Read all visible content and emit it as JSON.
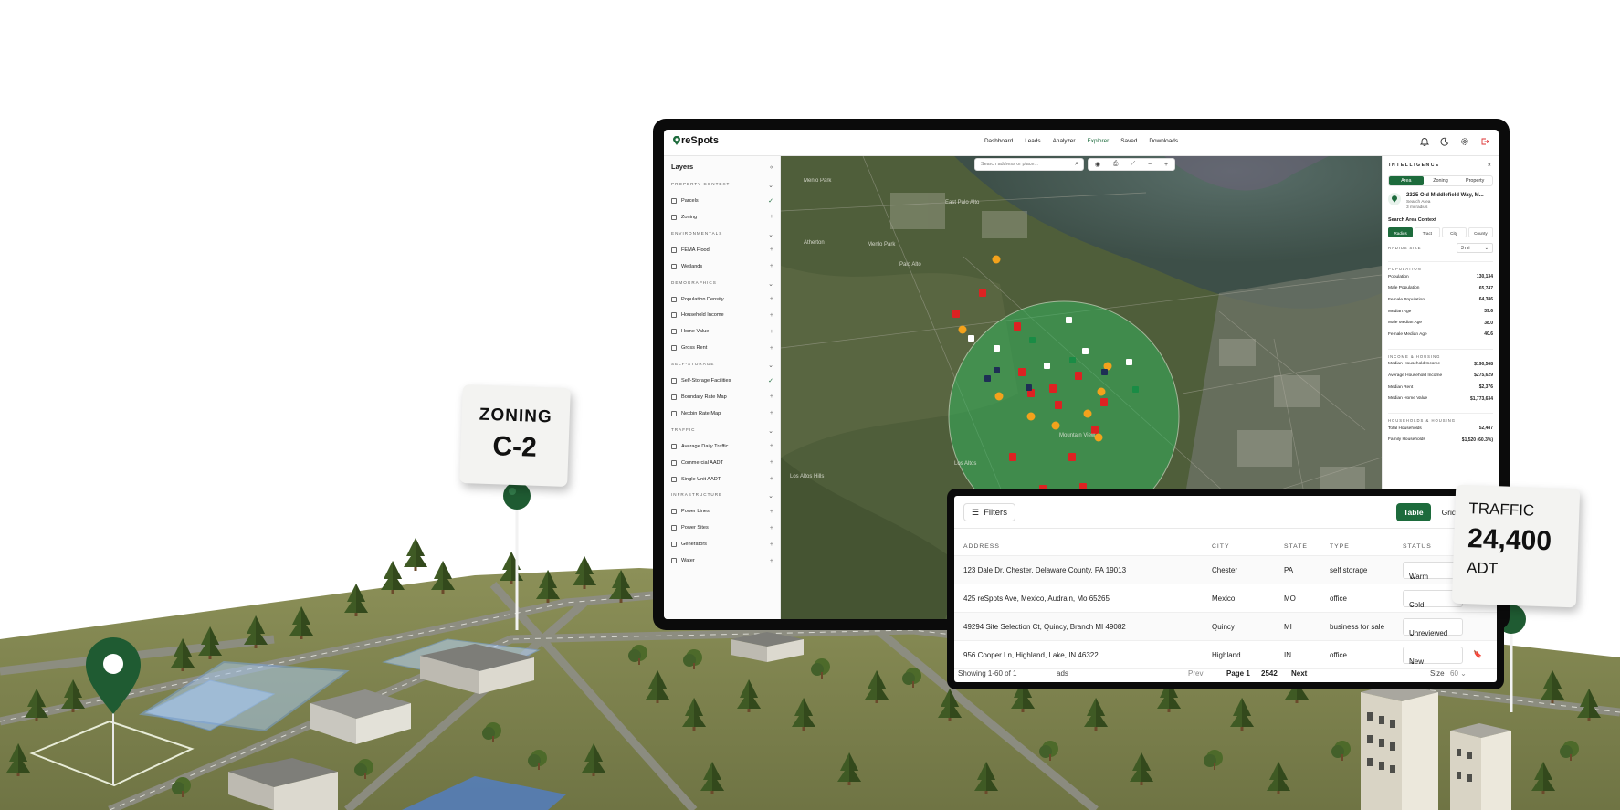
{
  "app": {
    "brand": "reSpots",
    "nav": [
      "Dashboard",
      "Leads",
      "Analyzer",
      "Explorer",
      "Saved",
      "Downloads"
    ],
    "active_nav": "Explorer",
    "accent": "#1d6b3c"
  },
  "layers": {
    "title": "Layers",
    "collapse_icon": "double-chevron-left-icon",
    "groups": [
      {
        "title": "PROPERTY CONTEXT",
        "items": [
          {
            "label": "Parcels",
            "on": true
          },
          {
            "label": "Zoning",
            "on": false
          }
        ]
      },
      {
        "title": "ENVIRONMENTALS",
        "items": [
          {
            "label": "FEMA Flood",
            "on": false
          },
          {
            "label": "Wetlands",
            "on": false
          }
        ]
      },
      {
        "title": "DEMOGRAPHICS",
        "items": [
          {
            "label": "Population Density",
            "on": false
          },
          {
            "label": "Household Income",
            "on": false
          },
          {
            "label": "Home Value",
            "on": false
          },
          {
            "label": "Gross Rent",
            "on": false
          }
        ]
      },
      {
        "title": "SELF-STORAGE",
        "items": [
          {
            "label": "Self-Storage Facilities",
            "on": true
          },
          {
            "label": "Boundary Rate Map",
            "on": false
          },
          {
            "label": "Nexbin Rate Map",
            "on": false
          }
        ]
      },
      {
        "title": "TRAFFIC",
        "items": [
          {
            "label": "Average Daily Traffic",
            "on": false
          },
          {
            "label": "Commercial AADT",
            "on": false
          },
          {
            "label": "Single Unit AADT",
            "on": false
          }
        ]
      },
      {
        "title": "INFRASTRUCTURE",
        "items": [
          {
            "label": "Power Lines",
            "on": false
          },
          {
            "label": "Power Sites",
            "on": false
          },
          {
            "label": "Generators",
            "on": false
          },
          {
            "label": "Water",
            "on": false
          }
        ]
      }
    ]
  },
  "map": {
    "search_placeholder": "Search address or place...",
    "zoom_out": "−",
    "zoom_in": "+"
  },
  "intel": {
    "title": "INTELLIGENCE",
    "tabs": [
      "Area",
      "Zoning",
      "Property"
    ],
    "active_tab": "Area",
    "address": "2325 Old Middlefield Way, M...",
    "address_sub1": "Search Area",
    "address_sub2": "3 mi radius",
    "context_title": "Search Area Context",
    "context_tabs": [
      "Radius",
      "Tract",
      "City",
      "County"
    ],
    "active_context": "Radius",
    "radius_label": "RADIUS SIZE",
    "radius_value": "3 mi",
    "population_title": "POPULATION",
    "population": [
      {
        "k": "Population",
        "v": "130,134"
      },
      {
        "k": "Male Population",
        "v": "65,747"
      },
      {
        "k": "Female Population",
        "v": "64,386"
      },
      {
        "k": "Median Age",
        "v": "39.6"
      },
      {
        "k": "Male Median Age",
        "v": "38.0"
      },
      {
        "k": "Female Median Age",
        "v": "40.6"
      }
    ],
    "income_title": "INCOME & HOUSING",
    "income": [
      {
        "k": "Median Household Income",
        "v": "$190,568"
      },
      {
        "k": "Average Household Income",
        "v": "$275,629"
      },
      {
        "k": "Median Rent",
        "v": "$2,376"
      },
      {
        "k": "Median Home Value",
        "v": "$1,773,634"
      }
    ],
    "households_title": "HOUSEHOLDS & HOUSING",
    "households": [
      {
        "k": "Total Households",
        "v": "52,487"
      },
      {
        "k": "Family Households",
        "v": "$1,520 (60.3%)"
      }
    ]
  },
  "table": {
    "filters_label": "Filters",
    "view_table": "Table",
    "view_grid": "Grid",
    "columns": [
      "ADDRESS",
      "CITY",
      "STATE",
      "TYPE",
      "STATUS"
    ],
    "rows": [
      {
        "address": "123 Dale Dr, Chester, Delaware County, PA 19013",
        "city": "Chester",
        "state": "PA",
        "type": "self storage",
        "status": "Warm"
      },
      {
        "address": "425 reSpots Ave, Mexico, Audrain, Mo 65265",
        "city": "Mexico",
        "state": "MO",
        "type": "office",
        "status": "Cold"
      },
      {
        "address": "49294 Site Selection Ct, Quincy, Branch MI 49082",
        "city": "Quincy",
        "state": "MI",
        "type": "business for sale",
        "status": "Unreviewed"
      },
      {
        "address": "956 Cooper Ln, Highland, Lake, IN 46322",
        "city": "Highland",
        "state": "IN",
        "type": "office",
        "status": "New"
      }
    ],
    "footer_left": "Showing 1-60 of 1",
    "footer_left_end": "ads",
    "prev": "Previ",
    "page_label": "Page 1",
    "page_total": "2542",
    "next": "Next",
    "size_label": "Size",
    "size_value": "60"
  },
  "signs": {
    "zoning_title": "ZONING",
    "zoning_value": "C-2",
    "traffic_title": "TRAFFIC",
    "traffic_value": "24,400",
    "traffic_unit": "ADT"
  }
}
